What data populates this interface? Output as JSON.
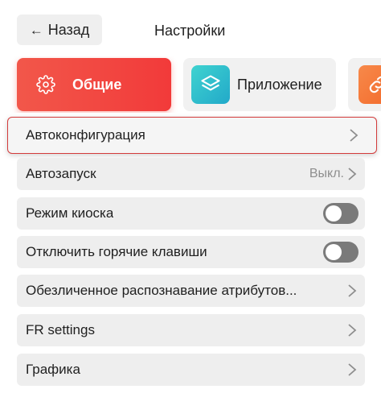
{
  "header": {
    "back_label": "Назад",
    "back_arrow": "←",
    "title": "Настройки"
  },
  "tabs": [
    {
      "label": "Общие",
      "icon": "gear-icon",
      "active": true,
      "color": "#f24a42"
    },
    {
      "label": "Приложение",
      "icon": "layers-icon",
      "active": false,
      "color": "#2bbad0"
    },
    {
      "label": "",
      "icon": "link-icon",
      "active": false,
      "color": "#f47a3a"
    }
  ],
  "settings": {
    "autoconfig": {
      "label": "Автоконфигурация"
    },
    "autostart": {
      "label": "Автозапуск",
      "value": "Выкл."
    },
    "kiosk_mode": {
      "label": "Режим киоска",
      "enabled": false
    },
    "disable_hotkeys": {
      "label": "Отключить горячие клавиши",
      "enabled": false
    },
    "anonymized_attributes": {
      "label": "Обезличенное распознавание атрибутов..."
    },
    "fr_settings": {
      "label": "FR settings"
    },
    "graphics": {
      "label": "Графика"
    }
  },
  "colors": {
    "accent": "#f24a42",
    "highlight_border": "#d33b3b",
    "row_bg": "#eeeeee",
    "toggle_off": "#7a7a7a"
  }
}
